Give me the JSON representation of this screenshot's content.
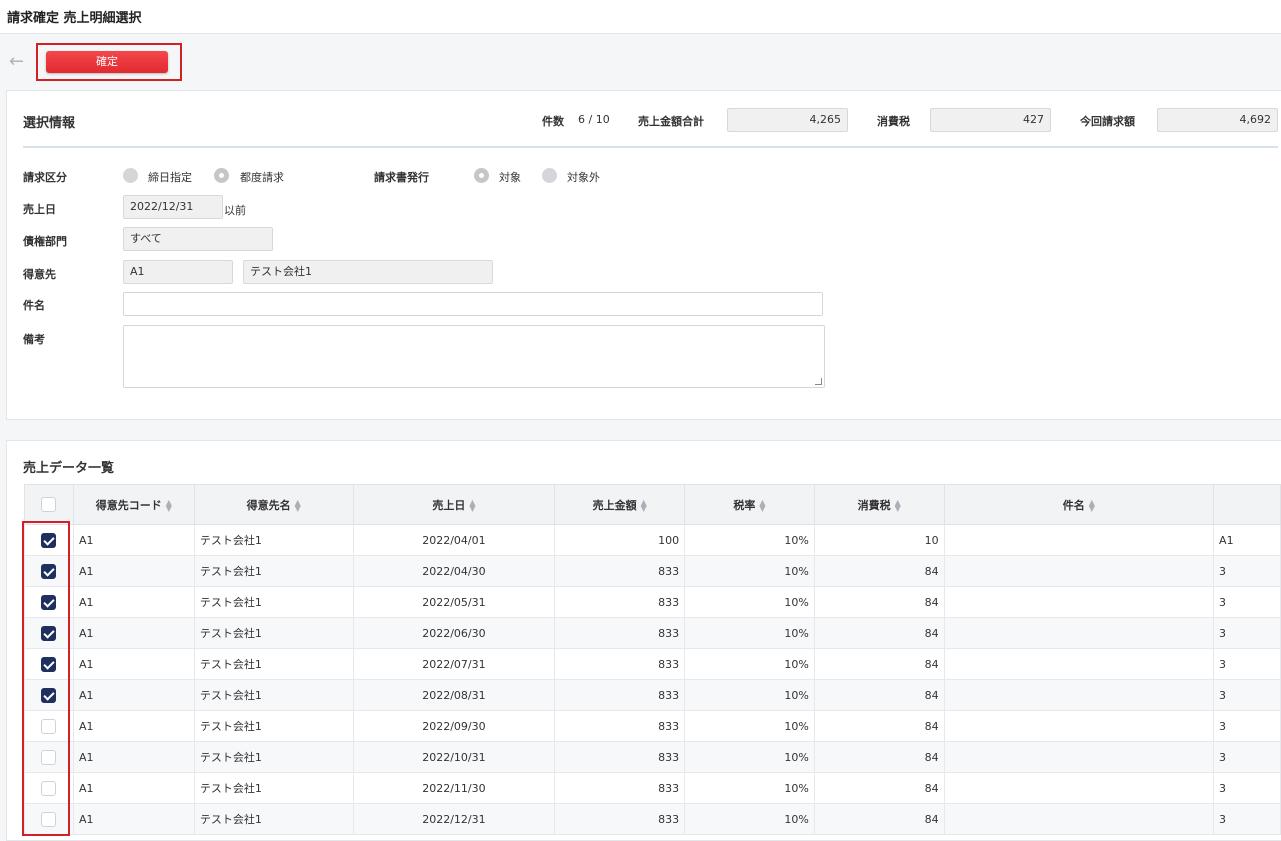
{
  "header": {
    "title": "請求確定 売上明細選択"
  },
  "toolbar": {
    "confirm_label": "確定",
    "back_icon": "arrow-left-icon"
  },
  "selection_info": {
    "title": "選択情報",
    "count_label": "件数",
    "count_value": "6 / 10",
    "sales_total_label": "売上金額合計",
    "sales_total_value": "4,265",
    "tax_label": "消費税",
    "tax_value": "427",
    "invoice_label": "今回請求額",
    "invoice_value": "4,692"
  },
  "form": {
    "billing_type_label": "請求区分",
    "billing_type_options": [
      "締日指定",
      "都度請求"
    ],
    "billing_type_selected": "都度請求",
    "invoice_issue_label": "請求書発行",
    "invoice_issue_options": [
      "対象",
      "対象外"
    ],
    "invoice_issue_selected": "対象",
    "sales_date_label": "売上日",
    "sales_date_value": "2022/12/31",
    "sales_date_suffix": "以前",
    "department_label": "債権部門",
    "department_value": "すべて",
    "customer_label": "得意先",
    "customer_code": "A1",
    "customer_name": "テスト会社1",
    "subject_label": "件名",
    "subject_value": "",
    "remarks_label": "備考",
    "remarks_value": ""
  },
  "sales_list": {
    "title": "売上データ一覧",
    "columns": [
      "",
      "得意先コード",
      "得意先名",
      "売上日",
      "売上金額",
      "税率",
      "消費税",
      "件名",
      ""
    ],
    "rows": [
      {
        "checked": true,
        "code": "A1",
        "name": "テスト会社1",
        "date": "2022/04/01",
        "amount": "100",
        "rate": "10%",
        "tax": "10",
        "subject": "",
        "extra": "A1"
      },
      {
        "checked": true,
        "code": "A1",
        "name": "テスト会社1",
        "date": "2022/04/30",
        "amount": "833",
        "rate": "10%",
        "tax": "84",
        "subject": "",
        "extra": "3"
      },
      {
        "checked": true,
        "code": "A1",
        "name": "テスト会社1",
        "date": "2022/05/31",
        "amount": "833",
        "rate": "10%",
        "tax": "84",
        "subject": "",
        "extra": "3"
      },
      {
        "checked": true,
        "code": "A1",
        "name": "テスト会社1",
        "date": "2022/06/30",
        "amount": "833",
        "rate": "10%",
        "tax": "84",
        "subject": "",
        "extra": "3"
      },
      {
        "checked": true,
        "code": "A1",
        "name": "テスト会社1",
        "date": "2022/07/31",
        "amount": "833",
        "rate": "10%",
        "tax": "84",
        "subject": "",
        "extra": "3"
      },
      {
        "checked": true,
        "code": "A1",
        "name": "テスト会社1",
        "date": "2022/08/31",
        "amount": "833",
        "rate": "10%",
        "tax": "84",
        "subject": "",
        "extra": "3"
      },
      {
        "checked": false,
        "code": "A1",
        "name": "テスト会社1",
        "date": "2022/09/30",
        "amount": "833",
        "rate": "10%",
        "tax": "84",
        "subject": "",
        "extra": "3"
      },
      {
        "checked": false,
        "code": "A1",
        "name": "テスト会社1",
        "date": "2022/10/31",
        "amount": "833",
        "rate": "10%",
        "tax": "84",
        "subject": "",
        "extra": "3"
      },
      {
        "checked": false,
        "code": "A1",
        "name": "テスト会社1",
        "date": "2022/11/30",
        "amount": "833",
        "rate": "10%",
        "tax": "84",
        "subject": "",
        "extra": "3"
      },
      {
        "checked": false,
        "code": "A1",
        "name": "テスト会社1",
        "date": "2022/12/31",
        "amount": "833",
        "rate": "10%",
        "tax": "84",
        "subject": "",
        "extra": "3"
      }
    ]
  },
  "colors": {
    "accent_red": "#e12a30",
    "checkbox_navy": "#1f2f5e",
    "highlight_red": "#d32027"
  }
}
